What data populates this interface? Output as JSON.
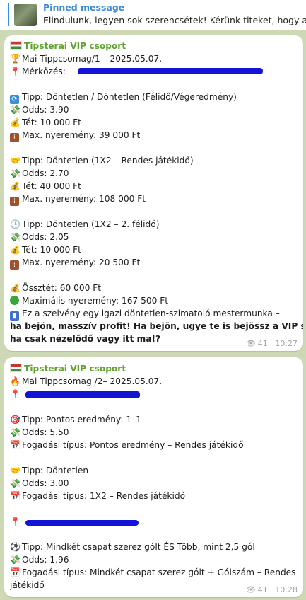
{
  "pinned": {
    "title": "Pinned message",
    "text": "Elindulunk, legyen sok szerencsétek! Kérünk titeket, hogy a tipp-s"
  },
  "messages": [
    {
      "sender": "Tipsterai VIP csoport",
      "lines": [
        {
          "icon": "trophy-icon",
          "glyph": "🏆",
          "text": "Mai Tippcsomag/1 – 2025.05.07."
        },
        {
          "icon": "pin-icon",
          "glyph": "📍",
          "text": "Mérkőzés:"
        },
        {
          "icon": "repeat-icon",
          "glyph": "🔁",
          "text": "Tipp: Döntetlen / Döntetlen (Félidő/Végeredmény)"
        },
        {
          "icon": "money-icon",
          "glyph": "💸",
          "text": "Odds: 3.90"
        },
        {
          "icon": "moneybag-icon",
          "glyph": "💰",
          "text": "Tét: 10 000 Ft"
        },
        {
          "icon": "abacus-icon",
          "glyph": "🧮",
          "text": "Max. nyeremény: 39 000 Ft"
        },
        {
          "icon": "handshake-icon",
          "glyph": "🤝",
          "text": "Tipp: Döntetlen (1X2 – Rendes játékidő)"
        },
        {
          "icon": "money-icon",
          "glyph": "💸",
          "text": "Odds: 2.70"
        },
        {
          "icon": "moneybag-icon",
          "glyph": "💰",
          "text": "Tét: 40 000 Ft"
        },
        {
          "icon": "abacus-icon",
          "glyph": "🧮",
          "text": "Max. nyeremény: 108 000 Ft"
        },
        {
          "icon": "clock-icon",
          "glyph": "🕒",
          "text": "Tipp: Döntetlen (1X2 – 2. félidő)"
        },
        {
          "icon": "money-icon",
          "glyph": "💸",
          "text": "Odds: 2.05"
        },
        {
          "icon": "moneybag-icon",
          "glyph": "💰",
          "text": "Tét: 10 000 Ft"
        },
        {
          "icon": "abacus-icon",
          "glyph": "🧮",
          "text": "Max. nyeremény: 20 500 Ft"
        },
        {
          "icon": "moneybag-icon",
          "glyph": "💰",
          "text": "Össztét: 60 000 Ft"
        },
        {
          "icon": "green-circle-icon",
          "glyph": "🟢",
          "text": "Maximális nyeremény: 167 500 Ft"
        }
      ],
      "closing_plain": "Ez a szelvény egy igazi döntetlen-szimatoló mestermunka – ",
      "closing_bold_1": "ha bejön, masszív profit!  Ha bejön, ugye te is bejössz a VIP szekcióba,",
      "closing_bold_2": "ha csak nézelődő vagy itt ma!?",
      "views": "41",
      "time": "10:27"
    },
    {
      "sender": "Tipsterai VIP csoport",
      "lines": [
        {
          "icon": "fire-icon",
          "glyph": "🔥",
          "text": "Mai Tippcsomag /2– 2025.05.07."
        },
        {
          "icon": "pin-icon",
          "glyph": "📍",
          "text": ""
        },
        {
          "icon": "target-icon",
          "glyph": "🎯",
          "text": "Tipp: Pontos eredmény: 1–1"
        },
        {
          "icon": "money-icon",
          "glyph": "💸",
          "text": "Odds: 5.50"
        },
        {
          "icon": "calendar-icon",
          "glyph": "📅",
          "text": "Fogadási típus: Pontos eredmény – Rendes játékidő"
        },
        {
          "icon": "handshake-icon",
          "glyph": "🤝",
          "text": "Tipp: Döntetlen"
        },
        {
          "icon": "money-icon",
          "glyph": "💸",
          "text": "Odds: 3.00"
        },
        {
          "icon": "calendar-icon",
          "glyph": "📅",
          "text": "Fogadási típus: 1X2 – Rendes játékidő"
        },
        {
          "icon": "pin-icon",
          "glyph": "📍",
          "text": ""
        },
        {
          "icon": "soccer-ball-icon",
          "glyph": "⚽",
          "text": "Tipp: Mindkét csapat szerez gólt ÉS Több, mint 2,5 gól"
        },
        {
          "icon": "money-icon",
          "glyph": "💸",
          "text": "Odds: 1.96"
        },
        {
          "icon": "calendar-icon",
          "glyph": "📅",
          "text": "Fogadási típus: Mindkét csapat szerez gólt + Gólszám – Rendes"
        }
      ],
      "wrap_text": "játékidő",
      "views": "41",
      "time": "10:28"
    }
  ],
  "colors": {
    "background": "#cdd9b5",
    "accent": "#3390ec",
    "sender": "#5fa32d",
    "redaction": "#1414d6"
  }
}
